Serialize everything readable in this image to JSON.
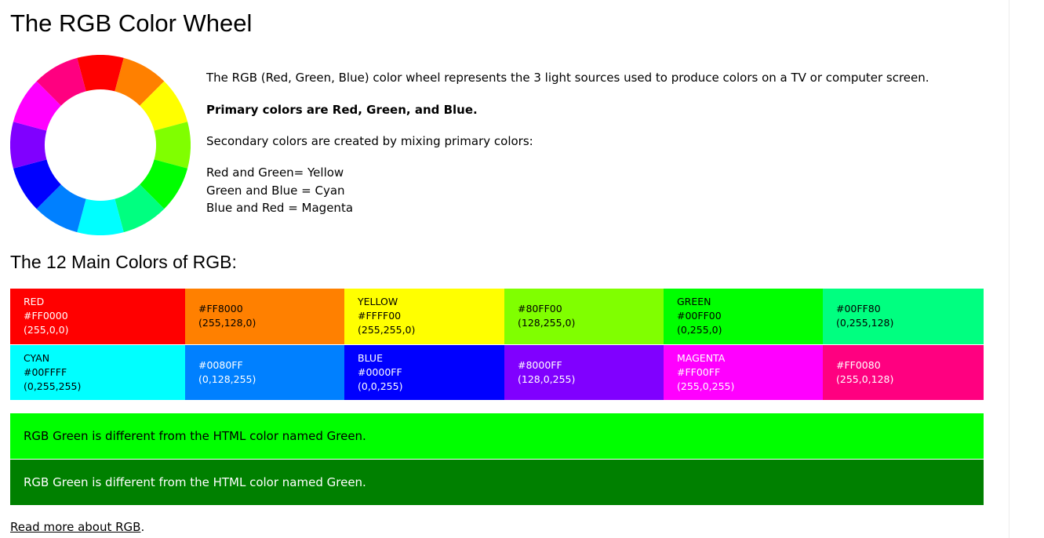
{
  "page": {
    "title": "The RGB Color Wheel",
    "intro": {
      "p1": "The RGB (Red, Green, Blue) color wheel represents the 3 light sources used to produce colors on a TV or computer screen.",
      "p2": "Primary colors are Red, Green, and Blue.",
      "p3": "Secondary colors are created by mixing primary colors:",
      "mix": [
        "Red and Green= Yellow",
        "Green and Blue = Cyan",
        "Blue and Red = Magenta"
      ]
    },
    "subtitle": "The 12 Main Colors of RGB:",
    "wheel_colors": [
      "#FF0000",
      "#FF8000",
      "#FFFF00",
      "#80FF00",
      "#00FF00",
      "#00FF80",
      "#00FFFF",
      "#0080FF",
      "#0000FF",
      "#8000FF",
      "#FF00FF",
      "#FF0080"
    ],
    "rows": [
      [
        {
          "name": "RED",
          "hex": "#FF0000",
          "rgb": "(255,0,0)",
          "bg": "#FF0000",
          "text": "light"
        },
        {
          "name": "",
          "hex": "#FF8000",
          "rgb": "(255,128,0)",
          "bg": "#FF8000",
          "text": "dark"
        },
        {
          "name": "YELLOW",
          "hex": "#FFFF00",
          "rgb": "(255,255,0)",
          "bg": "#FFFF00",
          "text": "dark"
        },
        {
          "name": "",
          "hex": "#80FF00",
          "rgb": "(128,255,0)",
          "bg": "#80FF00",
          "text": "dark"
        },
        {
          "name": "GREEN",
          "hex": "#00FF00",
          "rgb": "(0,255,0)",
          "bg": "#00FF00",
          "text": "dark"
        },
        {
          "name": "",
          "hex": "#00FF80",
          "rgb": "(0,255,128)",
          "bg": "#00FF80",
          "text": "dark"
        }
      ],
      [
        {
          "name": "CYAN",
          "hex": "#00FFFF",
          "rgb": "(0,255,255)",
          "bg": "#00FFFF",
          "text": "dark"
        },
        {
          "name": "",
          "hex": "#0080FF",
          "rgb": "(0,128,255)",
          "bg": "#0080FF",
          "text": "light"
        },
        {
          "name": "BLUE",
          "hex": "#0000FF",
          "rgb": "(0,0,255)",
          "bg": "#0000FF",
          "text": "light"
        },
        {
          "name": "",
          "hex": "#8000FF",
          "rgb": "(128,0,255)",
          "bg": "#8000FF",
          "text": "light"
        },
        {
          "name": "MAGENTA",
          "hex": "#FF00FF",
          "rgb": "(255,0,255)",
          "bg": "#FF00FF",
          "text": "light"
        },
        {
          "name": "",
          "hex": "#FF0080",
          "rgb": "(255,0,128)",
          "bg": "#FF0080",
          "text": "light"
        }
      ]
    ],
    "notes": [
      {
        "text": "RGB Green is different from the HTML color named Green.",
        "bg": "#00FF00"
      },
      {
        "text": "RGB Green is different from the HTML color named Green.",
        "bg": "#008000"
      }
    ],
    "read_more": {
      "link": "Read more about RGB",
      "suffix": "."
    }
  }
}
